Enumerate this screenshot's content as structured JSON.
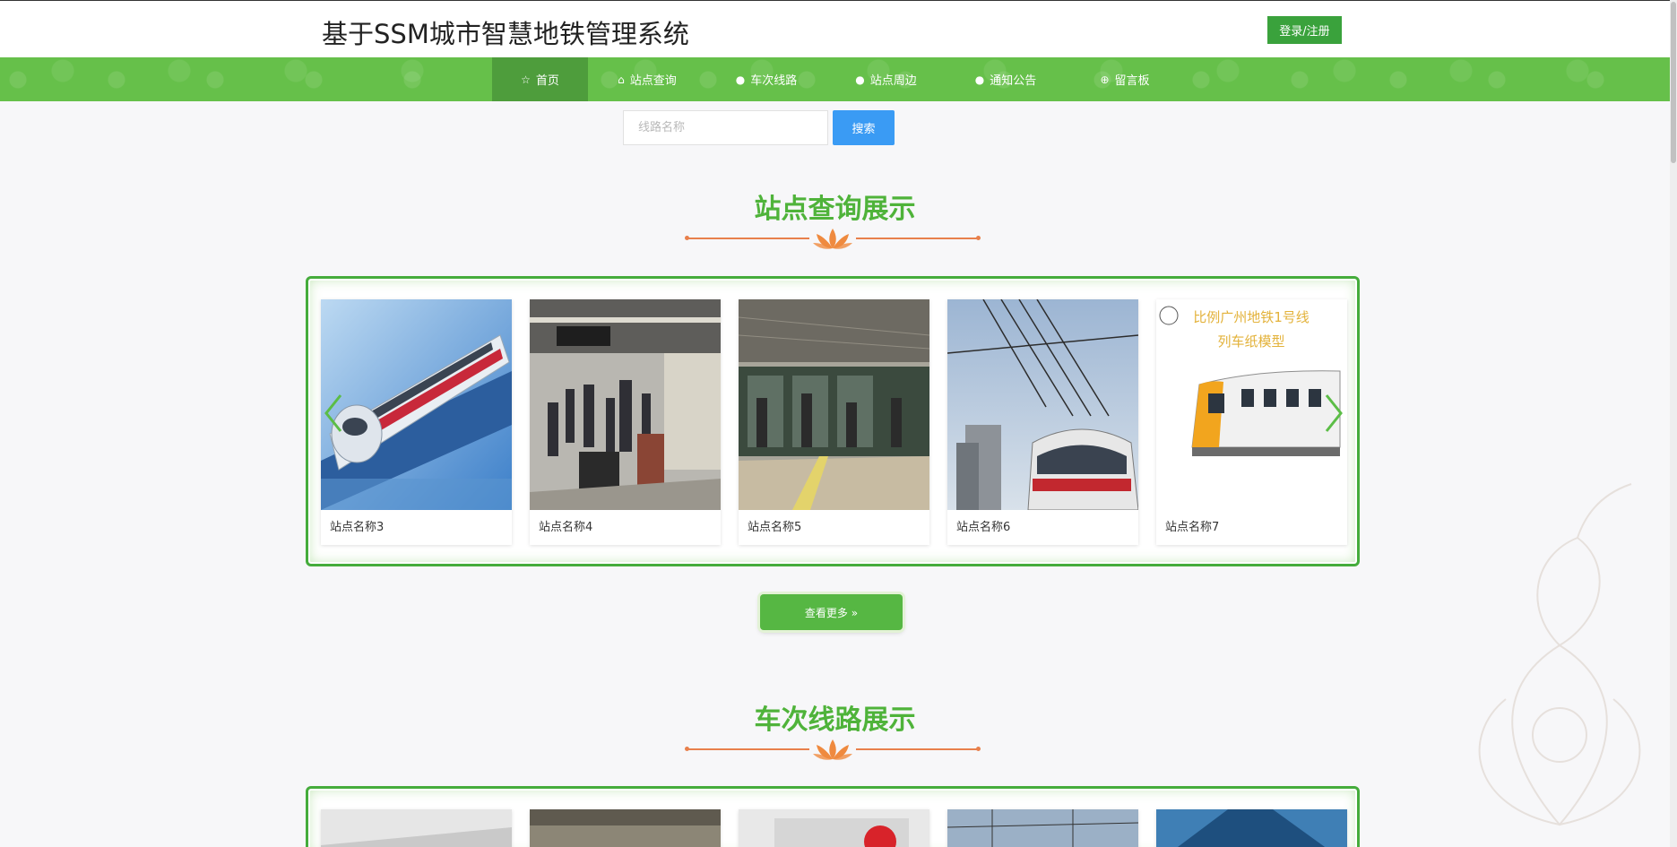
{
  "header": {
    "title": "基于SSM城市智慧地铁管理系统",
    "login_label": "登录/注册"
  },
  "nav": {
    "items": [
      {
        "label": "首页",
        "icon": "star-icon"
      },
      {
        "label": "站点查询",
        "icon": "home-icon"
      },
      {
        "label": "车次线路",
        "icon": "info-circle-icon"
      },
      {
        "label": "站点周边",
        "icon": "info-circle-icon"
      },
      {
        "label": "通知公告",
        "icon": "info-circle-icon"
      },
      {
        "label": "留言板",
        "icon": "globe-icon"
      }
    ],
    "active_index": 0
  },
  "search": {
    "placeholder": "线路名称",
    "button_label": "搜索"
  },
  "stations_section": {
    "title": "站点查询展示",
    "cards": [
      {
        "caption": "站点名称3"
      },
      {
        "caption": "站点名称4"
      },
      {
        "caption": "站点名称5"
      },
      {
        "caption": "站点名称6"
      },
      {
        "caption": "站点名称7",
        "image_text_line1": "比例广州地铁1号线",
        "image_text_line2": "列车纸模型"
      }
    ],
    "more_label": "查看更多 »"
  },
  "routes_section": {
    "title": "车次线路展示"
  },
  "colors": {
    "brand_green": "#4fb33a",
    "nav_green": "#66c04a",
    "nav_active": "#4e9d3c",
    "search_blue": "#3a9bf4",
    "divider_orange": "#e8804c"
  }
}
